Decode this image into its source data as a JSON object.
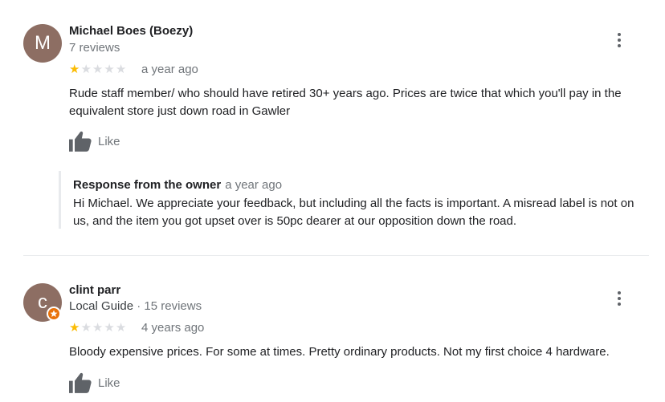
{
  "reviews": [
    {
      "avatar_letter": "M",
      "name": "Michael Boes (Boezy)",
      "meta": "7 reviews",
      "rating": 1,
      "age": "a year ago",
      "text": "Rude staff member/ who should have retired 30+ years ago. Prices are twice that which you'll pay in the equivalent store just down road in Gawler",
      "like_label": "Like",
      "response": {
        "title": "Response from the owner",
        "age": "a year ago",
        "text": "Hi Michael. We appreciate your feedback, but including all the facts is important. A misread label is not on us, and the item you got upset over is 50pc dearer at our opposition down the road."
      }
    },
    {
      "avatar_letter": "c",
      "name": "clint parr",
      "local_guide": "Local Guide",
      "separator": "·",
      "meta": "15 reviews",
      "rating": 1,
      "age": "4 years ago",
      "text": "Bloody expensive prices. For some at times. Pretty ordinary products. Not my first choice 4 hardware.",
      "like_label": "Like"
    }
  ],
  "icons": {
    "more": "more-vert-icon",
    "like": "thumbs-up-icon",
    "star": "star-icon",
    "guide": "local-guide-badge-icon"
  },
  "colors": {
    "star_on": "#fbbc04",
    "star_off": "#dadce0",
    "avatar": "#8d6e63",
    "guide_badge": "#e8710a"
  }
}
